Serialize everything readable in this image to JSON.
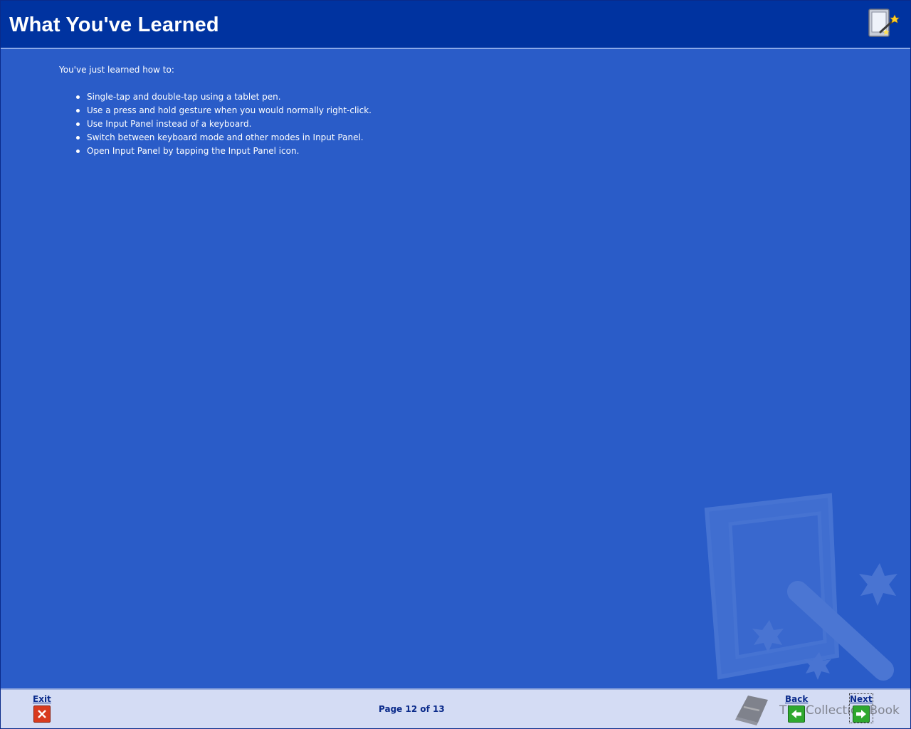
{
  "header": {
    "title": "What You've Learned",
    "icon": "tablet-pen-icon"
  },
  "content": {
    "intro": "You've just learned how to:",
    "bullets": [
      "Single-tap and double-tap using a tablet pen.",
      "Use a press and hold gesture when you would normally right-click.",
      "Use Input Panel instead of a keyboard.",
      "Switch between keyboard mode and other modes in Input Panel.",
      "Open Input Panel by tapping the Input Panel icon."
    ]
  },
  "footer": {
    "exit_label": "Exit",
    "back_label": "Back",
    "next_label": "Next",
    "page_indicator": "Page 12 of 13",
    "brand_text": "The Collection Book"
  },
  "colors": {
    "background": "#2a5cc8",
    "header": "#0033a0",
    "footer": "#d4dcf4",
    "exit_icon": "#d83a1e",
    "arrow_icon": "#2fa82f"
  }
}
